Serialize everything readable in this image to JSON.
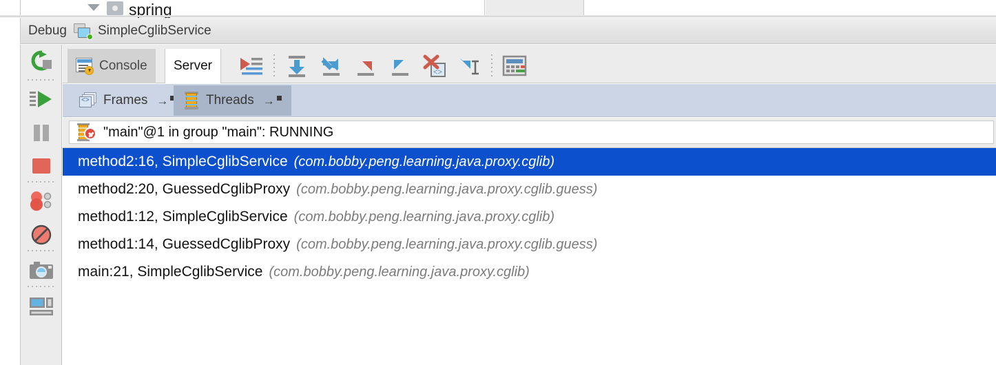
{
  "top_strip": {
    "tree_item_label": "spring",
    "expander_icon": "chevron-down-icon",
    "module_icon": "module-icon"
  },
  "debug_header": {
    "label": "Debug",
    "session_name": "SimpleCglibService",
    "process_icon": "running-process-icon"
  },
  "left_rail": {
    "items": [
      {
        "name": "rerun-button",
        "icon": "rerun-icon",
        "label": "Rerun"
      },
      {
        "name": "resume-program-button",
        "icon": "resume-icon",
        "label": "Resume Program"
      },
      {
        "name": "pause-program-button",
        "icon": "pause-icon",
        "label": "Pause Program"
      },
      {
        "name": "stop-button",
        "icon": "stop-icon",
        "label": "Stop"
      },
      {
        "name": "view-breakpoints-button",
        "icon": "breakpoints-icon",
        "label": "View Breakpoints"
      },
      {
        "name": "mute-breakpoints-button",
        "icon": "mute-breakpoints-icon",
        "label": "Mute Breakpoints"
      },
      {
        "name": "get-thread-dump-button",
        "icon": "camera-icon",
        "label": "Get Thread Dump"
      },
      {
        "name": "layout-settings-button",
        "icon": "layout-icon",
        "label": "Layout Settings"
      }
    ]
  },
  "tabs": [
    {
      "label": "Console",
      "icon": "console-icon",
      "active": false
    },
    {
      "label": "Server",
      "icon": "",
      "active": true
    }
  ],
  "debug_actions": [
    {
      "name": "show-execution-point-button",
      "icon": "show-execution-point-icon",
      "label": "Show Execution Point"
    },
    {
      "name": "step-over-button",
      "icon": "step-over-icon",
      "label": "Step Over"
    },
    {
      "name": "step-into-button",
      "icon": "step-into-icon",
      "label": "Step Into"
    },
    {
      "name": "force-step-into-button",
      "icon": "force-step-into-icon",
      "label": "Force Step Into"
    },
    {
      "name": "step-out-button",
      "icon": "step-out-icon",
      "label": "Step Out"
    },
    {
      "name": "drop-frame-button",
      "icon": "drop-frame-icon",
      "label": "Drop Frame"
    },
    {
      "name": "run-to-cursor-button",
      "icon": "run-to-cursor-icon",
      "label": "Run to Cursor"
    },
    {
      "name": "evaluate-expression-button",
      "icon": "calculator-icon",
      "label": "Evaluate Expression"
    }
  ],
  "subtabs": [
    {
      "label": "Frames",
      "icon": "frames-icon",
      "selected": false,
      "detach_arrow": "→",
      "detach_square": "■"
    },
    {
      "label": "Threads",
      "icon": "thread-spool-icon",
      "selected": true,
      "detach_arrow": "→",
      "detach_square": "■"
    }
  ],
  "thread_status": {
    "icon": "thread-suspended-icon",
    "text": "\"main\"@1 in group \"main\": RUNNING"
  },
  "frames": [
    {
      "location": "method2:16, SimpleCglibService",
      "package": "(com.bobby.peng.learning.java.proxy.cglib)",
      "selected": true
    },
    {
      "location": "method2:20, GuessedCglibProxy",
      "package": "(com.bobby.peng.learning.java.proxy.cglib.guess)",
      "selected": false
    },
    {
      "location": "method1:12, SimpleCglibService",
      "package": "(com.bobby.peng.learning.java.proxy.cglib)",
      "selected": false
    },
    {
      "location": "method1:14, GuessedCglibProxy",
      "package": "(com.bobby.peng.learning.java.proxy.cglib.guess)",
      "selected": false
    },
    {
      "location": "main:21, SimpleCglibService",
      "package": "(com.bobby.peng.learning.java.proxy.cglib)",
      "selected": false
    }
  ],
  "colors": {
    "selection_blue": "#0d50cd",
    "subtab_bar": "#cbd5e6",
    "subtab_selected": "#a9b5c9",
    "toolbar_bg": "#ececec",
    "tab_inactive": "#d2d2d2",
    "package_text": "#7b7b7b"
  }
}
